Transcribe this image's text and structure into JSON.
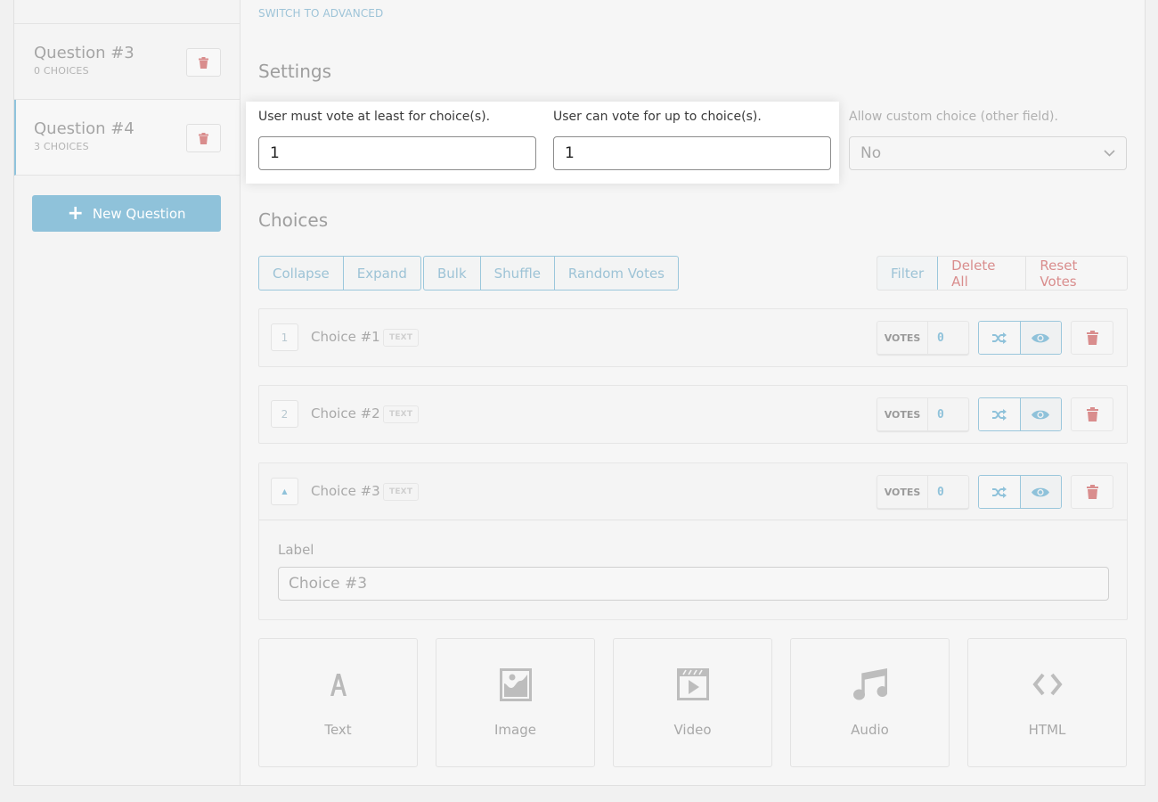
{
  "sidebar": {
    "questions": [
      {
        "title": "Question #3",
        "subtitle": "0 CHOICES",
        "active": false
      },
      {
        "title": "Question #4",
        "subtitle": "3 CHOICES",
        "active": true
      }
    ],
    "new_question_label": "New Question"
  },
  "main": {
    "switch_advanced": "SWITCH TO ADVANCED",
    "settings_heading": "Settings",
    "settings": {
      "min_votes": {
        "label": "User must vote at least for choice(s).",
        "value": "1"
      },
      "max_votes": {
        "label": "User can vote for up to choice(s).",
        "value": "1"
      },
      "custom_choice": {
        "label": "Allow custom choice (other field).",
        "value": "No"
      }
    },
    "choices_heading": "Choices",
    "toolbar": {
      "group1": [
        "Collapse",
        "Expand"
      ],
      "group2": [
        "Bulk",
        "Shuffle",
        "Random Votes"
      ],
      "group3": [
        "Filter",
        "Delete All",
        "Reset Votes"
      ]
    },
    "choices": [
      {
        "number": "1",
        "label": "Choice #1",
        "type": "TEXT",
        "votes_label": "VOTES",
        "votes": "0",
        "expanded": false
      },
      {
        "number": "2",
        "label": "Choice #2",
        "type": "TEXT",
        "votes_label": "VOTES",
        "votes": "0",
        "expanded": false
      },
      {
        "number": "▲",
        "label": "Choice #3",
        "type": "TEXT",
        "votes_label": "VOTES",
        "votes": "0",
        "expanded": true,
        "field_label": "Label",
        "field_value": "Choice #3"
      }
    ],
    "choice_types": [
      {
        "label": "Text",
        "icon": "text-icon"
      },
      {
        "label": "Image",
        "icon": "image-icon"
      },
      {
        "label": "Video",
        "icon": "video-icon"
      },
      {
        "label": "Audio",
        "icon": "audio-icon"
      },
      {
        "label": "HTML",
        "icon": "code-icon"
      }
    ]
  },
  "colors": {
    "accent": "#8fc2da",
    "danger": "#d98d8d",
    "muted_text": "#a9a9a9"
  }
}
